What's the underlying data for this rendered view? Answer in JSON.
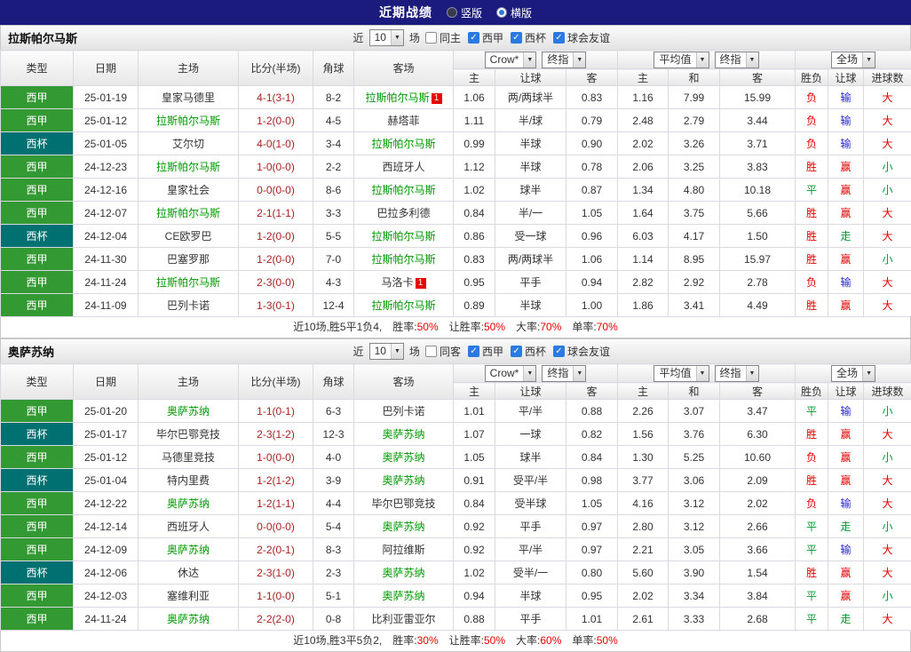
{
  "top_bar": {
    "title": "近期战绩",
    "radios": [
      {
        "label": "竖版",
        "selected": false
      },
      {
        "label": "横版",
        "selected": true
      }
    ]
  },
  "colors": {
    "topbar_bg": "#1b1b7e",
    "checkbox_blue": "#2a7ae2",
    "focus_team": "#009900",
    "score_text": "#aa2222",
    "stat_value": "#e60000",
    "badge_red": "#e60000",
    "type_colors": {
      "西甲": "#339933",
      "西杯": "#007070"
    },
    "result_color_map": {
      "胜": "#e60000",
      "平": "#009933",
      "负": "#e60000",
      "赢": "#e60000",
      "走": "#009933",
      "输": "#2626cc",
      "大": "#e60000",
      "小": "#009933"
    }
  },
  "sections": [
    {
      "team": "拉斯帕尔马斯",
      "controls": {
        "near_label": "近",
        "matches_value": "10",
        "matches_suffix": "场",
        "checkboxes": [
          {
            "label": "同主",
            "checked": false
          },
          {
            "label": "西甲",
            "checked": true
          },
          {
            "label": "西杯",
            "checked": true
          },
          {
            "label": "球会友谊",
            "checked": true
          }
        ]
      },
      "header": {
        "cols": [
          "类型",
          "日期",
          "主场",
          "比分(半场)",
          "角球",
          "客场"
        ],
        "odds_groups": [
          {
            "selects": [
              "Crow*",
              "终指"
            ],
            "subcols": [
              "主",
              "让球",
              "客"
            ]
          },
          {
            "selects": [
              "平均值",
              "终指"
            ],
            "subcols": [
              "主",
              "和",
              "客"
            ]
          },
          {
            "selects": [
              "全场"
            ],
            "subcols": [
              "胜负",
              "让球",
              "进球数"
            ]
          }
        ]
      },
      "rows": [
        {
          "type": "西甲",
          "date": "25-01-19",
          "home": "皇家马德里",
          "home_focus": false,
          "home_badge": "",
          "score": "4-1(3-1)",
          "corners": "8-2",
          "away": "拉斯帕尔马斯",
          "away_focus": true,
          "away_badge": "1",
          "odds": [
            "1.06",
            "两/两球半",
            "0.83",
            "1.16",
            "7.99",
            "15.99"
          ],
          "result": "负",
          "handicap_result": "输",
          "goals_result": "大"
        },
        {
          "type": "西甲",
          "date": "25-01-12",
          "home": "拉斯帕尔马斯",
          "home_focus": true,
          "home_badge": "",
          "score": "1-2(0-0)",
          "corners": "4-5",
          "away": "赫塔菲",
          "away_focus": false,
          "away_badge": "",
          "odds": [
            "1.11",
            "半/球",
            "0.79",
            "2.48",
            "2.79",
            "3.44"
          ],
          "result": "负",
          "handicap_result": "输",
          "goals_result": "大"
        },
        {
          "type": "西杯",
          "date": "25-01-05",
          "home": "艾尔切",
          "home_focus": false,
          "home_badge": "",
          "score": "4-0(1-0)",
          "corners": "3-4",
          "away": "拉斯帕尔马斯",
          "away_focus": true,
          "away_badge": "",
          "odds": [
            "0.99",
            "半球",
            "0.90",
            "2.02",
            "3.26",
            "3.71"
          ],
          "result": "负",
          "handicap_result": "输",
          "goals_result": "大"
        },
        {
          "type": "西甲",
          "date": "24-12-23",
          "home": "拉斯帕尔马斯",
          "home_focus": true,
          "home_badge": "",
          "score": "1-0(0-0)",
          "corners": "2-2",
          "away": "西班牙人",
          "away_focus": false,
          "away_badge": "",
          "odds": [
            "1.12",
            "半球",
            "0.78",
            "2.06",
            "3.25",
            "3.83"
          ],
          "result": "胜",
          "handicap_result": "赢",
          "goals_result": "小"
        },
        {
          "type": "西甲",
          "date": "24-12-16",
          "home": "皇家社会",
          "home_focus": false,
          "home_badge": "",
          "score": "0-0(0-0)",
          "corners": "8-6",
          "away": "拉斯帕尔马斯",
          "away_focus": true,
          "away_badge": "",
          "odds": [
            "1.02",
            "球半",
            "0.87",
            "1.34",
            "4.80",
            "10.18"
          ],
          "result": "平",
          "handicap_result": "赢",
          "goals_result": "小"
        },
        {
          "type": "西甲",
          "date": "24-12-07",
          "home": "拉斯帕尔马斯",
          "home_focus": true,
          "home_badge": "",
          "score": "2-1(1-1)",
          "corners": "3-3",
          "away": "巴拉多利德",
          "away_focus": false,
          "away_badge": "",
          "odds": [
            "0.84",
            "半/一",
            "1.05",
            "1.64",
            "3.75",
            "5.66"
          ],
          "result": "胜",
          "handicap_result": "赢",
          "goals_result": "大"
        },
        {
          "type": "西杯",
          "date": "24-12-04",
          "home": "CE欧罗巴",
          "home_focus": false,
          "home_badge": "",
          "score": "1-2(0-0)",
          "corners": "5-5",
          "away": "拉斯帕尔马斯",
          "away_focus": true,
          "away_badge": "",
          "odds": [
            "0.86",
            "受一球",
            "0.96",
            "6.03",
            "4.17",
            "1.50"
          ],
          "result": "胜",
          "handicap_result": "走",
          "goals_result": "大"
        },
        {
          "type": "西甲",
          "date": "24-11-30",
          "home": "巴塞罗那",
          "home_focus": false,
          "home_badge": "",
          "score": "1-2(0-0)",
          "corners": "7-0",
          "away": "拉斯帕尔马斯",
          "away_focus": true,
          "away_badge": "",
          "odds": [
            "0.83",
            "两/两球半",
            "1.06",
            "1.14",
            "8.95",
            "15.97"
          ],
          "result": "胜",
          "handicap_result": "赢",
          "goals_result": "小"
        },
        {
          "type": "西甲",
          "date": "24-11-24",
          "home": "拉斯帕尔马斯",
          "home_focus": true,
          "home_badge": "",
          "score": "2-3(0-0)",
          "corners": "4-3",
          "away": "马洛卡",
          "away_focus": false,
          "away_badge": "1",
          "odds": [
            "0.95",
            "平手",
            "0.94",
            "2.82",
            "2.92",
            "2.78"
          ],
          "result": "负",
          "handicap_result": "输",
          "goals_result": "大"
        },
        {
          "type": "西甲",
          "date": "24-11-09",
          "home": "巴列卡诺",
          "home_focus": false,
          "home_badge": "",
          "score": "1-3(0-1)",
          "corners": "12-4",
          "away": "拉斯帕尔马斯",
          "away_focus": true,
          "away_badge": "",
          "odds": [
            "0.89",
            "半球",
            "1.00",
            "1.86",
            "3.41",
            "4.49"
          ],
          "result": "胜",
          "handicap_result": "赢",
          "goals_result": "大"
        }
      ],
      "footer": {
        "summary": "近10场,胜5平1负4,",
        "stats": [
          {
            "label": "胜率:",
            "value": "50%"
          },
          {
            "label": "让胜率:",
            "value": "50%"
          },
          {
            "label": "大率:",
            "value": "70%"
          },
          {
            "label": "单率:",
            "value": "70%"
          }
        ]
      }
    },
    {
      "team": "奥萨苏纳",
      "controls": {
        "near_label": "近",
        "matches_value": "10",
        "matches_suffix": "场",
        "checkboxes": [
          {
            "label": "同客",
            "checked": false
          },
          {
            "label": "西甲",
            "checked": true
          },
          {
            "label": "西杯",
            "checked": true
          },
          {
            "label": "球会友谊",
            "checked": true
          }
        ]
      },
      "header": {
        "cols": [
          "类型",
          "日期",
          "主场",
          "比分(半场)",
          "角球",
          "客场"
        ],
        "odds_groups": [
          {
            "selects": [
              "Crow*",
              "终指"
            ],
            "subcols": [
              "主",
              "让球",
              "客"
            ]
          },
          {
            "selects": [
              "平均值",
              "终指"
            ],
            "subcols": [
              "主",
              "和",
              "客"
            ]
          },
          {
            "selects": [
              "全场"
            ],
            "subcols": [
              "胜负",
              "让球",
              "进球数"
            ]
          }
        ]
      },
      "rows": [
        {
          "type": "西甲",
          "date": "25-01-20",
          "home": "奥萨苏纳",
          "home_focus": true,
          "home_badge": "",
          "score": "1-1(0-1)",
          "corners": "6-3",
          "away": "巴列卡诺",
          "away_focus": false,
          "away_badge": "",
          "odds": [
            "1.01",
            "平/半",
            "0.88",
            "2.26",
            "3.07",
            "3.47"
          ],
          "result": "平",
          "handicap_result": "输",
          "goals_result": "小"
        },
        {
          "type": "西杯",
          "date": "25-01-17",
          "home": "毕尔巴鄂竞技",
          "home_focus": false,
          "home_badge": "",
          "score": "2-3(1-2)",
          "corners": "12-3",
          "away": "奥萨苏纳",
          "away_focus": true,
          "away_badge": "",
          "odds": [
            "1.07",
            "一球",
            "0.82",
            "1.56",
            "3.76",
            "6.30"
          ],
          "result": "胜",
          "handicap_result": "赢",
          "goals_result": "大"
        },
        {
          "type": "西甲",
          "date": "25-01-12",
          "home": "马德里竞技",
          "home_focus": false,
          "home_badge": "",
          "score": "1-0(0-0)",
          "corners": "4-0",
          "away": "奥萨苏纳",
          "away_focus": true,
          "away_badge": "",
          "odds": [
            "1.05",
            "球半",
            "0.84",
            "1.30",
            "5.25",
            "10.60"
          ],
          "result": "负",
          "handicap_result": "赢",
          "goals_result": "小"
        },
        {
          "type": "西杯",
          "date": "25-01-04",
          "home": "特内里费",
          "home_focus": false,
          "home_badge": "",
          "score": "1-2(1-2)",
          "corners": "3-9",
          "away": "奥萨苏纳",
          "away_focus": true,
          "away_badge": "",
          "odds": [
            "0.91",
            "受平/半",
            "0.98",
            "3.77",
            "3.06",
            "2.09"
          ],
          "result": "胜",
          "handicap_result": "赢",
          "goals_result": "大"
        },
        {
          "type": "西甲",
          "date": "24-12-22",
          "home": "奥萨苏纳",
          "home_focus": true,
          "home_badge": "",
          "score": "1-2(1-1)",
          "corners": "4-4",
          "away": "毕尔巴鄂竞技",
          "away_focus": false,
          "away_badge": "",
          "odds": [
            "0.84",
            "受半球",
            "1.05",
            "4.16",
            "3.12",
            "2.02"
          ],
          "result": "负",
          "handicap_result": "输",
          "goals_result": "大"
        },
        {
          "type": "西甲",
          "date": "24-12-14",
          "home": "西班牙人",
          "home_focus": false,
          "home_badge": "",
          "score": "0-0(0-0)",
          "corners": "5-4",
          "away": "奥萨苏纳",
          "away_focus": true,
          "away_badge": "",
          "odds": [
            "0.92",
            "平手",
            "0.97",
            "2.80",
            "3.12",
            "2.66"
          ],
          "result": "平",
          "handicap_result": "走",
          "goals_result": "小"
        },
        {
          "type": "西甲",
          "date": "24-12-09",
          "home": "奥萨苏纳",
          "home_focus": true,
          "home_badge": "",
          "score": "2-2(0-1)",
          "corners": "8-3",
          "away": "阿拉维斯",
          "away_focus": false,
          "away_badge": "",
          "odds": [
            "0.92",
            "平/半",
            "0.97",
            "2.21",
            "3.05",
            "3.66"
          ],
          "result": "平",
          "handicap_result": "输",
          "goals_result": "大"
        },
        {
          "type": "西杯",
          "date": "24-12-06",
          "home": "休达",
          "home_focus": false,
          "home_badge": "",
          "score": "2-3(1-0)",
          "corners": "2-3",
          "away": "奥萨苏纳",
          "away_focus": true,
          "away_badge": "",
          "odds": [
            "1.02",
            "受半/一",
            "0.80",
            "5.60",
            "3.90",
            "1.54"
          ],
          "result": "胜",
          "handicap_result": "赢",
          "goals_result": "大"
        },
        {
          "type": "西甲",
          "date": "24-12-03",
          "home": "塞维利亚",
          "home_focus": false,
          "home_badge": "",
          "score": "1-1(0-0)",
          "corners": "5-1",
          "away": "奥萨苏纳",
          "away_focus": true,
          "away_badge": "",
          "odds": [
            "0.94",
            "半球",
            "0.95",
            "2.02",
            "3.34",
            "3.84"
          ],
          "result": "平",
          "handicap_result": "赢",
          "goals_result": "小"
        },
        {
          "type": "西甲",
          "date": "24-11-24",
          "home": "奥萨苏纳",
          "home_focus": true,
          "home_badge": "",
          "score": "2-2(2-0)",
          "corners": "0-8",
          "away": "比利亚雷亚尔",
          "away_focus": false,
          "away_badge": "",
          "odds": [
            "0.88",
            "平手",
            "1.01",
            "2.61",
            "3.33",
            "2.68"
          ],
          "result": "平",
          "handicap_result": "走",
          "goals_result": "大"
        }
      ],
      "footer": {
        "summary": "近10场,胜3平5负2,",
        "stats": [
          {
            "label": "胜率:",
            "value": "30%"
          },
          {
            "label": "让胜率:",
            "value": "50%"
          },
          {
            "label": "大率:",
            "value": "60%"
          },
          {
            "label": "单率:",
            "value": "50%"
          }
        ]
      }
    }
  ]
}
